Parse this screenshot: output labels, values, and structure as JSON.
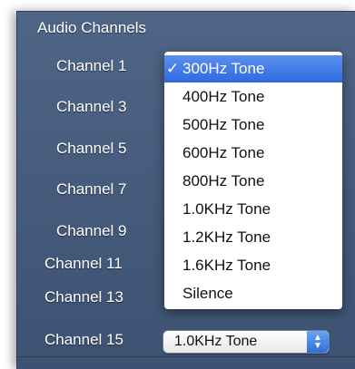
{
  "section": {
    "title": "Audio Channels"
  },
  "channels": [
    {
      "label": "Channel 1"
    },
    {
      "label": "Channel 3"
    },
    {
      "label": "Channel 5"
    },
    {
      "label": "Channel 7"
    },
    {
      "label": "Channel 9"
    },
    {
      "label": "Channel 11"
    },
    {
      "label": "Channel 13"
    },
    {
      "label": "Channel 15"
    }
  ],
  "dropdown": {
    "selected_value": "1.0KHz Tone",
    "stepper_icon": "up-down-arrows-icon",
    "accent_color": "#3a78e6"
  },
  "menu": {
    "check_mark": "✓",
    "items": [
      {
        "label": "300Hz Tone",
        "selected": true
      },
      {
        "label": "400Hz Tone",
        "selected": false
      },
      {
        "label": "500Hz Tone",
        "selected": false
      },
      {
        "label": "600Hz Tone",
        "selected": false
      },
      {
        "label": "800Hz Tone",
        "selected": false
      },
      {
        "label": "1.0KHz Tone",
        "selected": false
      },
      {
        "label": "1.2KHz Tone",
        "selected": false
      },
      {
        "label": "1.6KHz Tone",
        "selected": false
      },
      {
        "label": "Silence",
        "selected": false
      }
    ]
  }
}
